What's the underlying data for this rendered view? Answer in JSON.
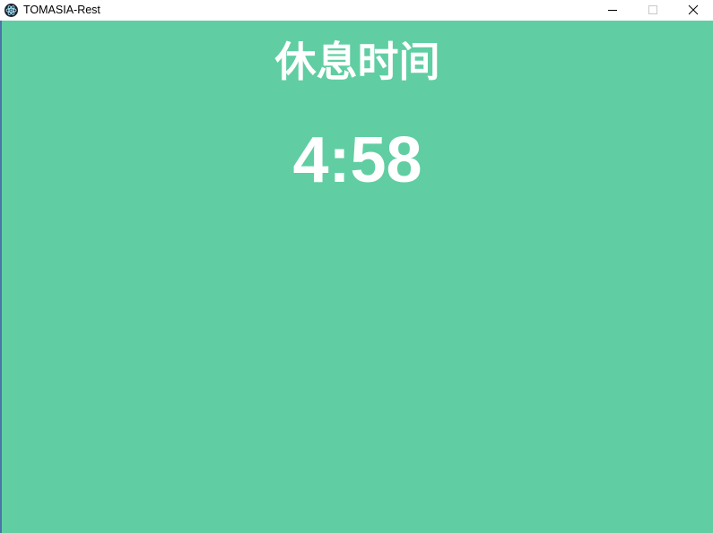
{
  "window": {
    "title": "TOMASIA-Rest",
    "icon": "electron-app-icon",
    "controls": {
      "minimize_icon": "minimize-icon",
      "maximize_icon": "maximize-icon",
      "close_icon": "close-icon"
    }
  },
  "main": {
    "heading": "休息时间",
    "countdown": "4:58"
  },
  "colors": {
    "background": "#60cea2",
    "text": "#ffffff",
    "titlebar": "#ffffff"
  }
}
